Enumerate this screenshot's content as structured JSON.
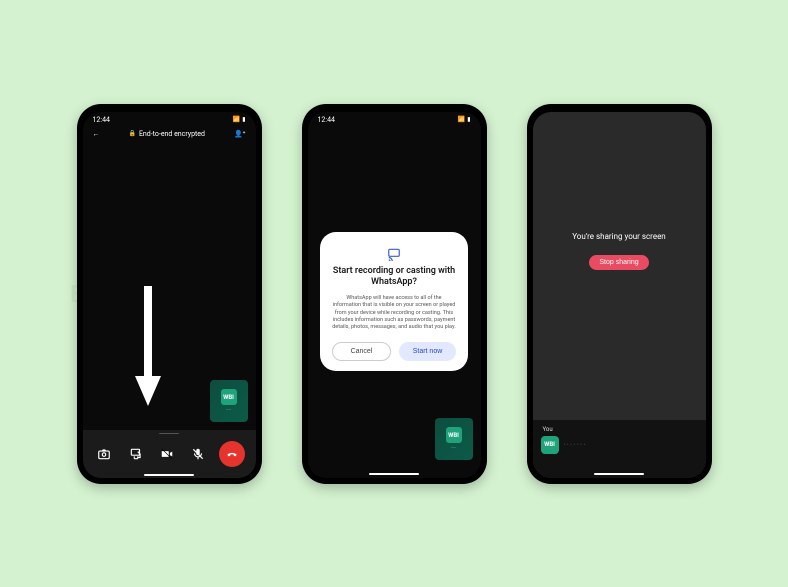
{
  "status": {
    "time": "12:44",
    "carrier_glyph": "📶",
    "battery_glyph": "▮"
  },
  "phone1": {
    "header": {
      "encryption": "End-to-end encrypted"
    },
    "pip": {
      "logo": "WBI",
      "sub": "·····"
    },
    "controls": {
      "camera_switch": "↺",
      "screen_share": "⎘",
      "video_off": "▢",
      "mic_mute": "✕",
      "end": "✆"
    }
  },
  "phone2": {
    "dialog": {
      "title": "Start recording or casting with WhatsApp?",
      "body": "WhatsApp will have access to all of the information that is visible on your screen or played from your device while recording or casting. This includes information such as passwords, payment details, photos, messages, and audio that you play.",
      "cancel": "Cancel",
      "start": "Start now"
    },
    "pip": {
      "logo": "WBI",
      "sub": "·····"
    }
  },
  "phone3": {
    "share_title": "You're sharing your screen",
    "stop": "Stop sharing",
    "you_label": "You",
    "you_logo": "WBI",
    "you_dots": "·······"
  }
}
